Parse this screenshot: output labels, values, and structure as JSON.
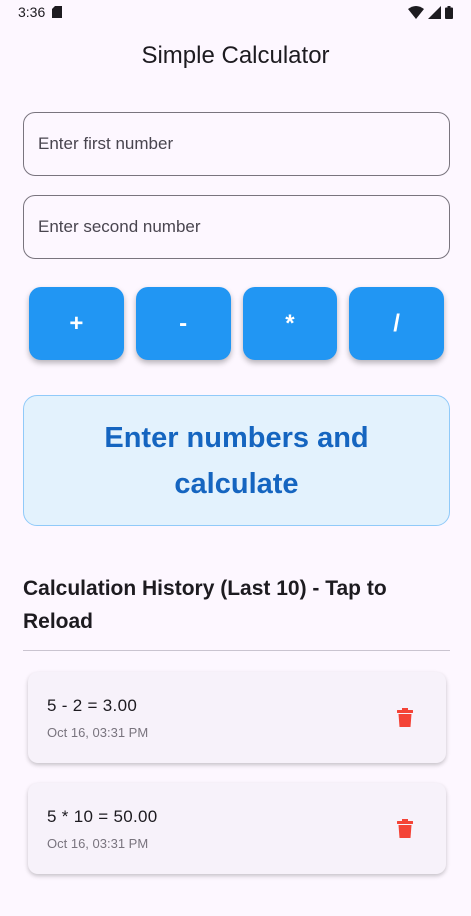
{
  "status_bar": {
    "time": "3:36"
  },
  "app": {
    "title": "Simple Calculator"
  },
  "inputs": {
    "first_placeholder": "Enter first number",
    "second_placeholder": "Enter second number"
  },
  "operations": [
    "+",
    "-",
    "*",
    "/"
  ],
  "result": {
    "text": "Enter numbers and calculate"
  },
  "history": {
    "title": "Calculation History (Last 10) - Tap to Reload",
    "items": [
      {
        "expression": "5 - 2 = 3.00",
        "timestamp": "Oct 16, 03:31 PM"
      },
      {
        "expression": "5 * 10 = 50.00",
        "timestamp": "Oct 16, 03:31 PM"
      }
    ]
  },
  "colors": {
    "accent": "#2196f3",
    "result_text": "#1565c0",
    "result_bg": "#e3f2fd",
    "delete": "#f44336"
  },
  "icons": [
    "sd-card-icon",
    "wifi-icon",
    "signal-icon",
    "battery-icon",
    "trash-icon"
  ]
}
